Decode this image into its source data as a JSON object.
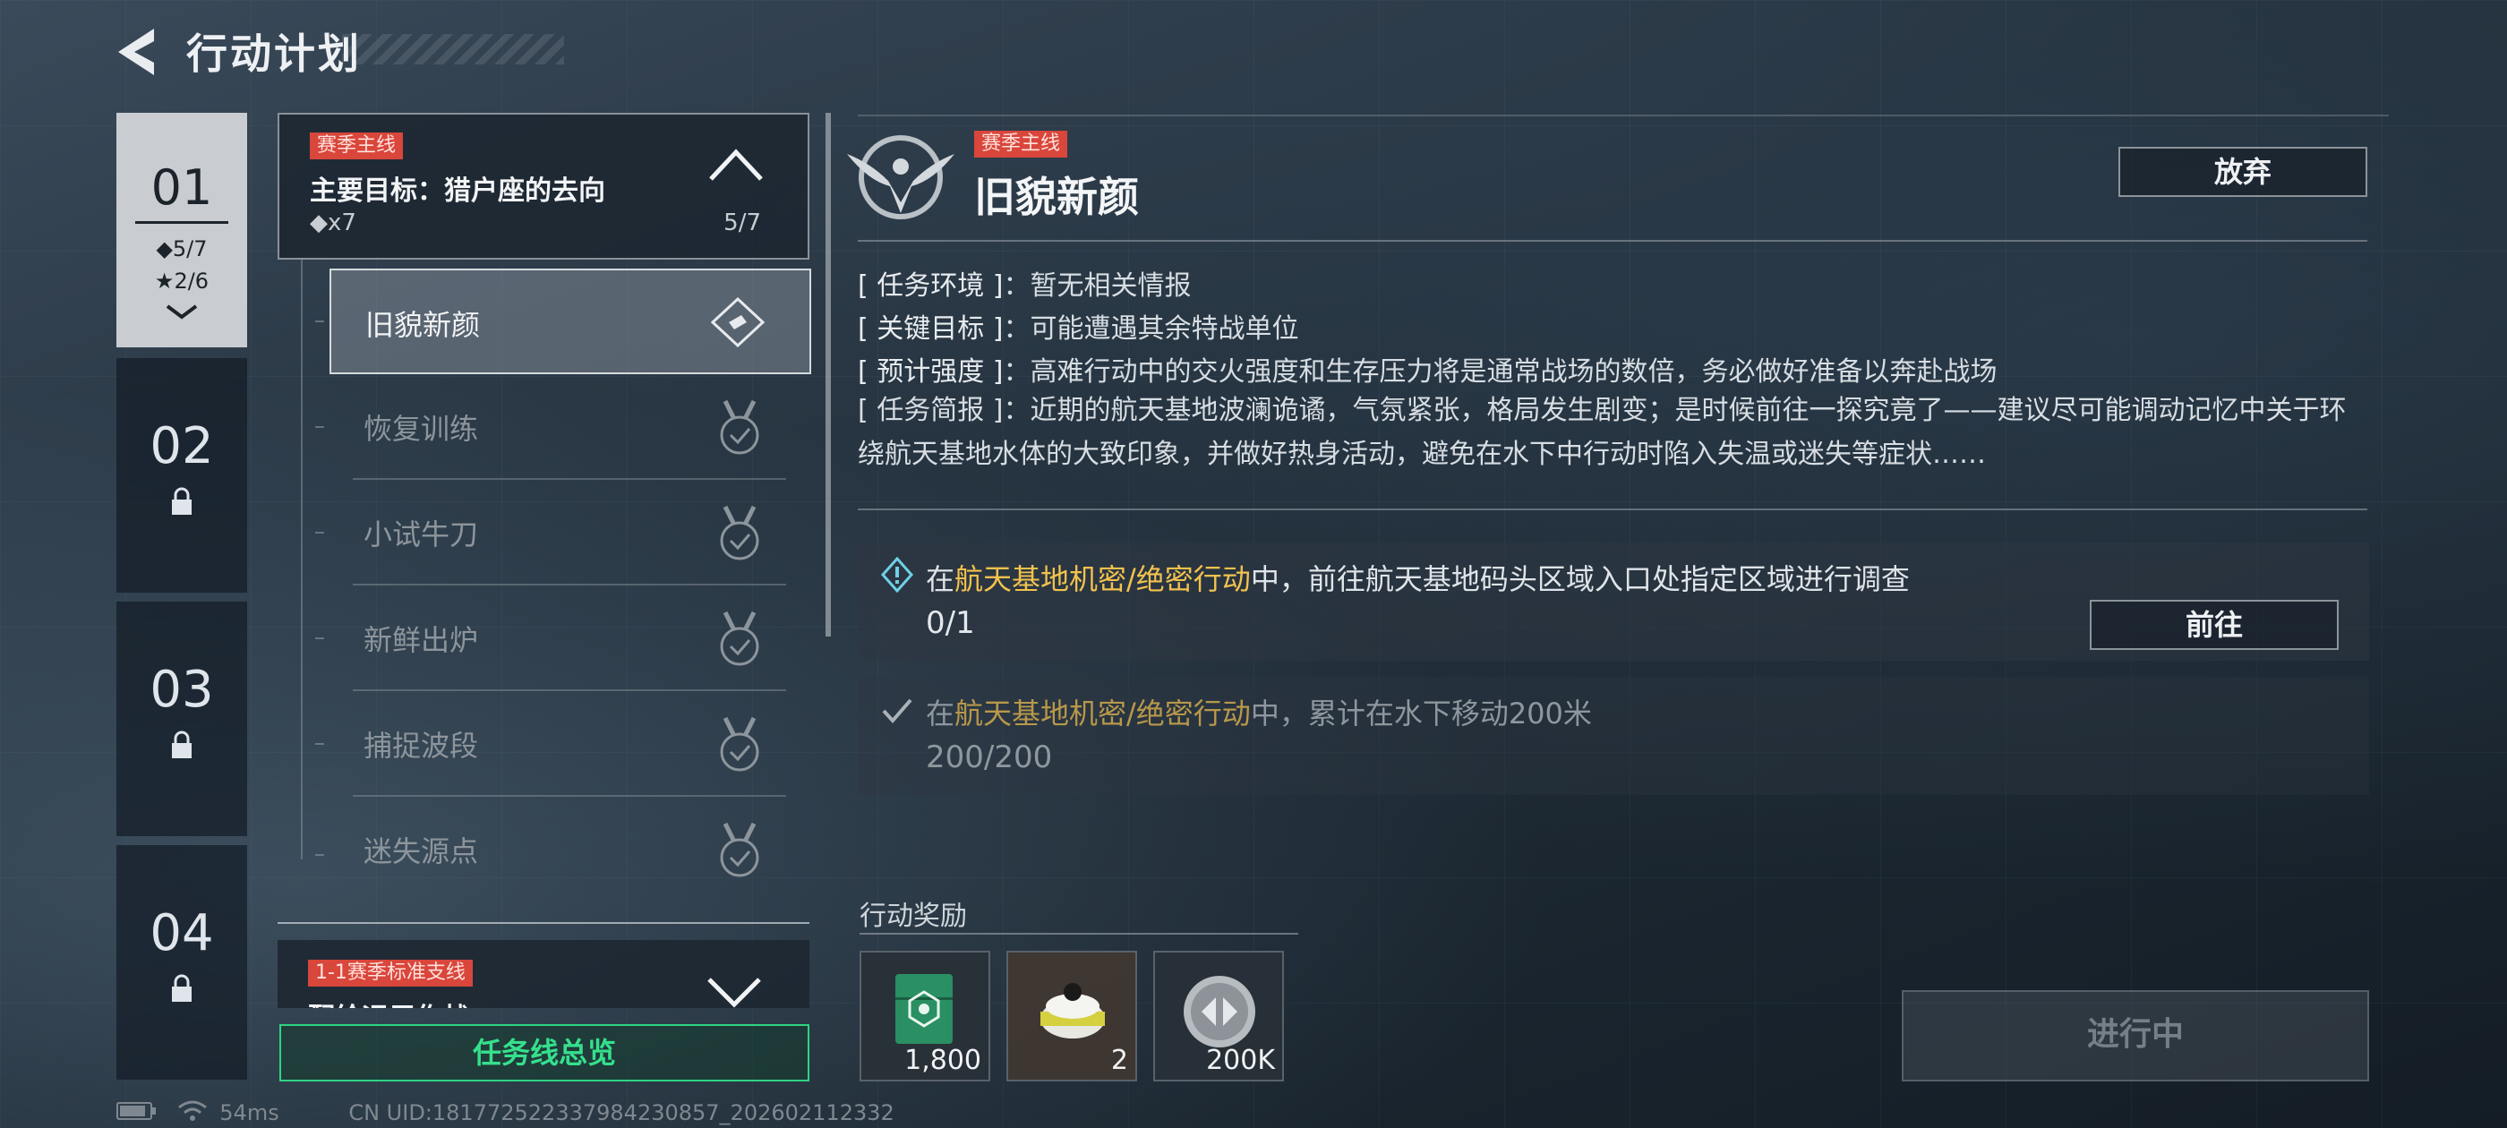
{
  "header": {
    "title": "行动计划"
  },
  "chapters": [
    {
      "num": "01",
      "diamonds": "◆5/7",
      "stars": "★2/6",
      "active": true
    },
    {
      "num": "02",
      "locked": true
    },
    {
      "num": "03",
      "locked": true
    },
    {
      "num": "04",
      "locked": true
    }
  ],
  "main_quest": {
    "tag": "赛季主线",
    "title": "主要目标：猎户座的去向",
    "reward": "◆x7",
    "progress": "5/7"
  },
  "sub_quests": [
    {
      "label": "旧貌新颜"
    },
    {
      "label": "恢复训练"
    },
    {
      "label": "小试牛刀"
    },
    {
      "label": "新鲜出炉"
    },
    {
      "label": "捕捉波段"
    },
    {
      "label": "迷失源点"
    }
  ],
  "branch_quest": {
    "tag": "1-1赛季标准支线",
    "title": "配给运用作战"
  },
  "overview_button": "任务线总览",
  "detail": {
    "tag": "赛季主线",
    "title": "旧貌新颜",
    "abandon": "放弃",
    "info": [
      {
        "key": "[ 任务环境 ]",
        "value": "：暂无相关情报"
      },
      {
        "key": "[ 关键目标 ]",
        "value": "：可能遭遇其余特战单位"
      },
      {
        "key": "[ 预计强度 ]",
        "value": "：高难行动中的交火强度和生存压力将是通常战场的数倍，务必做好准备以奔赴战场"
      }
    ],
    "brief_key": "[ 任务简报 ]",
    "brief_value": "：近期的航天基地波澜诡谲，气氛紧张，格局发生剧变；是时候前往一探究竟了——建议尽可能调动记忆中关于环绕航天基地水体的大致印象，并做好热身活动，避免在水下中行动时陷入失温或迷失等症状……",
    "objectives": [
      {
        "pre": "在",
        "hl": "航天基地机密/绝密行动",
        "post": "中，前往航天基地码头区域入口处指定区域进行调查",
        "progress": "0/1",
        "button": "前往",
        "done": false
      },
      {
        "pre": "在",
        "hl": "航天基地机密/绝密行动",
        "post": "中，累计在水下移动200米",
        "progress": "200/200",
        "done": true
      }
    ],
    "reward_title": "行动奖励",
    "rewards": [
      {
        "icon": "green-case-icon",
        "count": "1,800"
      },
      {
        "icon": "gas-canister-icon",
        "count": "2"
      },
      {
        "icon": "silver-coin-icon",
        "count": "200K"
      }
    ],
    "status_button": "进行中"
  },
  "status_bar": {
    "ping": "54ms",
    "uid": "CN UID:181772522337984230857_202602112332"
  },
  "colors": {
    "accent_green": "#35e08c",
    "tag_red": "#d9463b",
    "highlight_yellow": "#f2c24e"
  }
}
